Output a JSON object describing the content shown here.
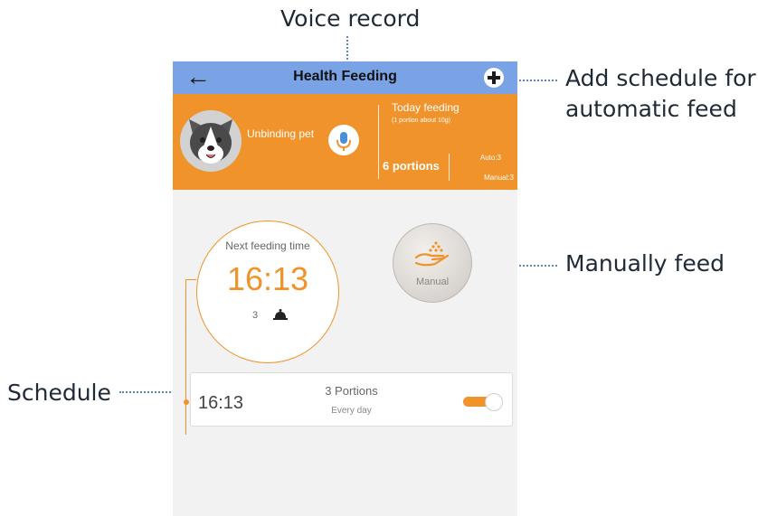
{
  "callouts": {
    "voice": "Voice record",
    "add_schedule_line1": "Add schedule for",
    "add_schedule_line2": "automatic feed",
    "manually": "Manually feed",
    "schedule": "Schedule"
  },
  "appbar": {
    "title": "Health Feeding"
  },
  "banner": {
    "pet_name": "Unbinding pet",
    "today_label": "Today feeding",
    "today_sub": "(1 portion about 10g)",
    "portions": "6 portions",
    "auto": "Auto:3",
    "manual": "Manual:3"
  },
  "next_feeding": {
    "label": "Next feeding time",
    "time": "16:13",
    "portions": "3"
  },
  "manual_button": {
    "label": "Manual"
  },
  "schedule": {
    "time": "16:13",
    "portions": "3 Portions",
    "repeat": "Every day",
    "enabled": true
  },
  "colors": {
    "accent": "#f0932a",
    "appbar": "#7aa3e5",
    "callout_line": "#5a86c4"
  },
  "icons": [
    "back-arrow-icon",
    "plus-icon",
    "microphone-icon",
    "dog-avatar",
    "food-bell-icon",
    "hand-feed-icon"
  ]
}
